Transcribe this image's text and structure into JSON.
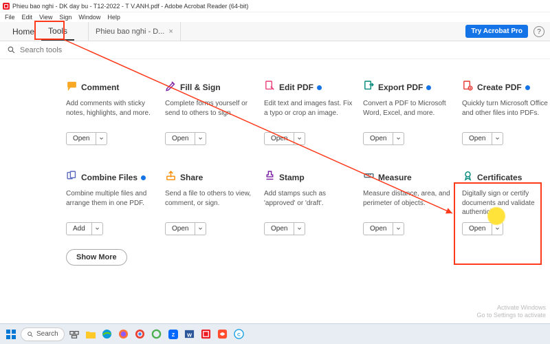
{
  "window": {
    "title": "Phieu bao nghi - DK day bu - T12-2022 - T V.ANH.pdf - Adobe Acrobat Reader (64-bit)"
  },
  "menu": {
    "file": "File",
    "edit": "Edit",
    "view": "View",
    "sign": "Sign",
    "window": "Window",
    "help": "Help"
  },
  "tabs": {
    "home": "Home",
    "tools": "Tools",
    "doc": "Phieu bao nghi - D...",
    "try": "Try Acrobat Pro"
  },
  "search": {
    "placeholder": "Search tools"
  },
  "cards": [
    {
      "icon": "comment",
      "iconColor": "#f9a825",
      "title": "Comment",
      "badge": false,
      "desc": "Add comments with sticky notes, highlights, and more.",
      "btn": "Open"
    },
    {
      "icon": "fillsign",
      "iconColor": "#7b1fa2",
      "title": "Fill & Sign",
      "badge": false,
      "desc": "Complete forms yourself or send to others to sign.",
      "btn": "Open"
    },
    {
      "icon": "editpdf",
      "iconColor": "#ec407a",
      "title": "Edit PDF",
      "badge": true,
      "desc": "Edit text and images fast. Fix a typo or crop an image.",
      "btn": "Open"
    },
    {
      "icon": "export",
      "iconColor": "#00897b",
      "title": "Export PDF",
      "badge": true,
      "desc": "Convert a PDF to Microsoft Word, Excel, and more.",
      "btn": "Open"
    },
    {
      "icon": "create",
      "iconColor": "#e53935",
      "title": "Create PDF",
      "badge": true,
      "desc": "Quickly turn Microsoft Office and other files into PDFs.",
      "btn": "Open"
    },
    {
      "icon": "combine",
      "iconColor": "#5c6bc0",
      "title": "Combine Files",
      "badge": true,
      "desc": "Combine multiple files and arrange them in one PDF.",
      "btn": "Add"
    },
    {
      "icon": "share",
      "iconColor": "#fb8c00",
      "title": "Share",
      "badge": false,
      "desc": "Send a file to others to view, comment, or sign.",
      "btn": "Open"
    },
    {
      "icon": "stamp",
      "iconColor": "#7b1fa2",
      "title": "Stamp",
      "badge": false,
      "desc": "Add stamps such as 'approved' or 'draft'.",
      "btn": "Open"
    },
    {
      "icon": "measure",
      "iconColor": "#546e7a",
      "title": "Measure",
      "badge": false,
      "desc": "Measure distance, area, and perimeter of objects.",
      "btn": "Open"
    },
    {
      "icon": "cert",
      "iconColor": "#00897b",
      "title": "Certificates",
      "badge": false,
      "desc": "Digitally sign or certify documents and validate authenticity.",
      "btn": "Open"
    }
  ],
  "showmore": "Show More",
  "activate": {
    "l1": "Activate Windows",
    "l2": "Go to Settings to activate"
  },
  "taskbar": {
    "search": "Search"
  }
}
